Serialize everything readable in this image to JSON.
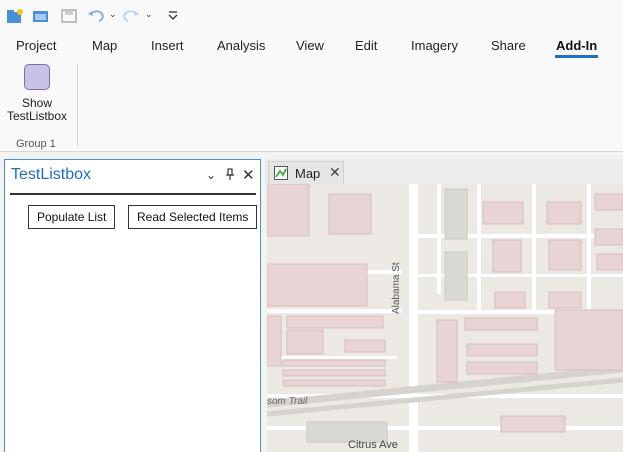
{
  "quick_access": {
    "icons": [
      "new-project-icon",
      "open-project-icon",
      "save-project-icon",
      "undo-icon",
      "redo-icon",
      "customize-icon"
    ]
  },
  "ribbon": {
    "tabs": [
      {
        "label": "Project"
      },
      {
        "label": "Map"
      },
      {
        "label": "Insert"
      },
      {
        "label": "Analysis"
      },
      {
        "label": "View"
      },
      {
        "label": "Edit"
      },
      {
        "label": "Imagery"
      },
      {
        "label": "Share"
      },
      {
        "label": "Add-In",
        "active": true
      }
    ],
    "show_button": {
      "line1": "Show",
      "line2": "TestListbox"
    },
    "group_label": "Group 1"
  },
  "dockpane": {
    "title": "TestListbox",
    "populate_label": "Populate List",
    "read_label": "Read Selected Items"
  },
  "map_view": {
    "tab_label": "Map",
    "labels": {
      "street_v": "Alabama St",
      "trail": "som Trail",
      "avenue": "Citrus Ave"
    }
  },
  "colors": {
    "accent": "#1f6fbf",
    "pane_border": "#4a90d0"
  }
}
